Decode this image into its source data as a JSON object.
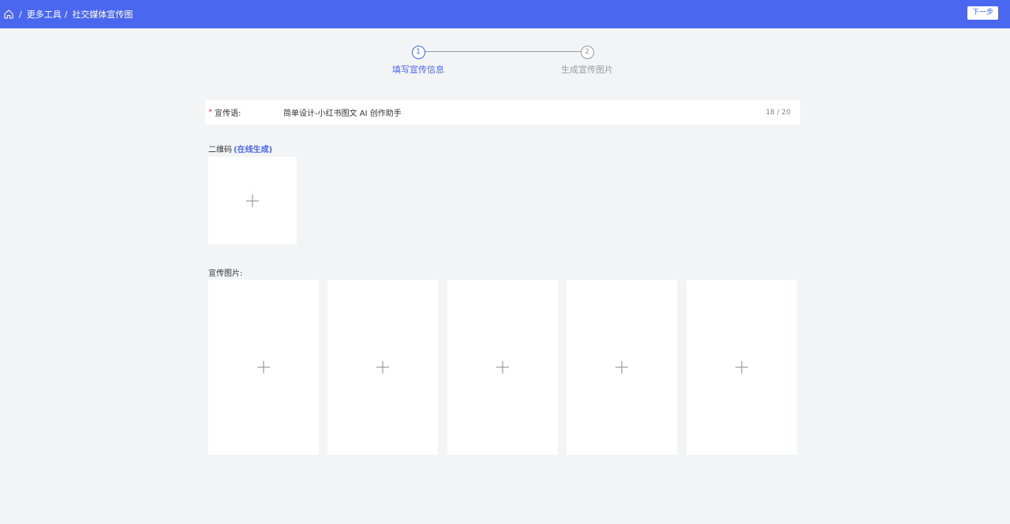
{
  "breadcrumb": {
    "items": [
      "更多工具",
      "社交媒体宣传图"
    ],
    "separator": "/"
  },
  "header": {
    "next_label": "下一步"
  },
  "steps": [
    {
      "number": "1",
      "label": "填写宣传信息",
      "active": true
    },
    {
      "number": "2",
      "label": "生成宣传图片",
      "active": false
    }
  ],
  "slogan": {
    "required_mark": "*",
    "label": "宣传语:",
    "value": "简单设计-小红书图文 AI 创作助手",
    "counter": "18 / 20"
  },
  "qrcode": {
    "label": "二维码",
    "link": "(在线生成)"
  },
  "promo": {
    "label": "宣传图片:"
  },
  "colors": {
    "accent": "#4a67f0",
    "background": "#f3f4f6",
    "required": "#e5484d"
  }
}
